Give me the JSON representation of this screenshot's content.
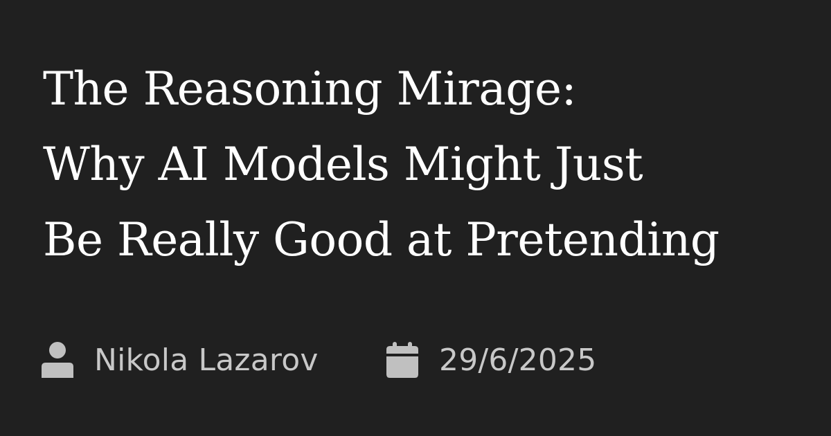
{
  "post": {
    "title_lines": [
      "The Reasoning Mirage:",
      "Why AI Models Might Just",
      "Be Really Good at Pretending"
    ],
    "author": {
      "name": "Nikola Lazarov",
      "icon": "user-icon"
    },
    "date": {
      "value": "29/6/2025",
      "icon": "calendar-icon"
    }
  },
  "colors": {
    "background": "#202020",
    "title_text": "#ffffff",
    "meta_text": "#c8c8c8",
    "icon_fill": "#c0c0c0"
  }
}
